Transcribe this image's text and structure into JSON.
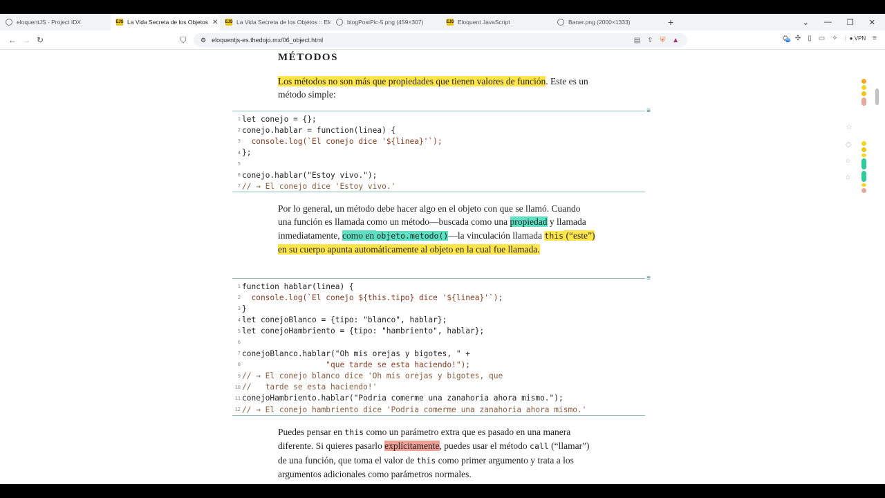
{
  "browser": {
    "tabs": [
      {
        "label": "eloquentJS - Project IDX",
        "favicon": "globe-icon",
        "active": false
      },
      {
        "label": "La Vida Secreta de los Objetos",
        "favicon": "ejs-icon",
        "active": true
      },
      {
        "label": "La Vida Secreta de los Objetos :: Elo",
        "favicon": "ejs-icon",
        "active": false
      },
      {
        "label": "blogPostPic-5.png (459×307)",
        "favicon": "globe-icon",
        "active": false
      },
      {
        "label": "Eloquent JavaScript",
        "favicon": "ejs-icon",
        "active": false
      },
      {
        "label": "Baner.png (2000×1333)",
        "favicon": "globe-icon",
        "active": false
      }
    ],
    "url": "eloquentjs-es.thedojo.mx/06_object.html",
    "vpn_label": "VPN",
    "badge_count": "46"
  },
  "content": {
    "heading": "MÉTODOS",
    "p1": {
      "hl": "Los métodos no son más que propiedades que tienen valores de función",
      "rest": ". Este es un método simple:"
    },
    "code1": [
      {
        "n": "1",
        "text": "let conejo = {};"
      },
      {
        "n": "2",
        "text": "conejo.hablar = function(linea) {"
      },
      {
        "n": "3",
        "text": "  console.log(`El conejo dice '${linea}'`);"
      },
      {
        "n": "4",
        "text": "};"
      },
      {
        "n": "5",
        "text": ""
      },
      {
        "n": "6",
        "text": "conejo.hablar(\"Estoy vivo.\");"
      },
      {
        "n": "7",
        "text": "// → El conejo dice 'Estoy vivo.'"
      }
    ],
    "p2": {
      "a": "Por lo general, un método debe hacer algo en el objeto con que se llamó. Cuando una función es llamada como un método—buscada como una ",
      "b": "propiedad",
      "c": " y llamada inmediatamente, ",
      "d": "como en ",
      "e": "objeto.metodo()",
      "f": "—la vinculación llamada ",
      "g": "this",
      "h": " (“este”) en su cuerpo apunta automáticamente al objeto en la cual fue llamada."
    },
    "code2": [
      {
        "n": "1",
        "text": "function hablar(linea) {"
      },
      {
        "n": "2",
        "text": "  console.log(`El conejo ${this.tipo} dice '${linea}'`);"
      },
      {
        "n": "3",
        "text": "}"
      },
      {
        "n": "4",
        "text": "let conejoBlanco = {tipo: \"blanco\", hablar};"
      },
      {
        "n": "5",
        "text": "let conejoHambriento = {tipo: \"hambriento\", hablar};"
      },
      {
        "n": "6",
        "text": ""
      },
      {
        "n": "7",
        "text": "conejoBlanco.hablar(\"Oh mis orejas y bigotes, \" +"
      },
      {
        "n": "8",
        "text": "                  \"que tarde se esta haciendo!\");"
      },
      {
        "n": "9",
        "text": "// → El conejo blanco dice 'Oh mis orejas y bigotes, que"
      },
      {
        "n": "10",
        "text": "//   tarde se esta haciendo!'"
      },
      {
        "n": "11",
        "text": "conejoHambriento.hablar(\"Podria comerme una zanahoria ahora mismo.\");"
      },
      {
        "n": "12",
        "text": "// → El conejo hambriento dice 'Podria comerme una zanahoria ahora mismo.'"
      }
    ],
    "p3": {
      "a": "Puedes pensar en ",
      "b": "this",
      "c": " como un parámetro extra que es pasado en una manera diferente. Si quieres pasarlo ",
      "d": "explícitamente",
      "e": ", puedes usar el método ",
      "f": "call",
      "g": " (“llamar”) de una función, que toma el valor de ",
      "h": "this",
      "i": " como primer argumento y trata a los argumentos adicionales como parámetros normales."
    }
  },
  "colors": {
    "highlight_yellow": "#ffe54a",
    "highlight_green": "#5de0c4",
    "highlight_red": "#ee9f96"
  }
}
